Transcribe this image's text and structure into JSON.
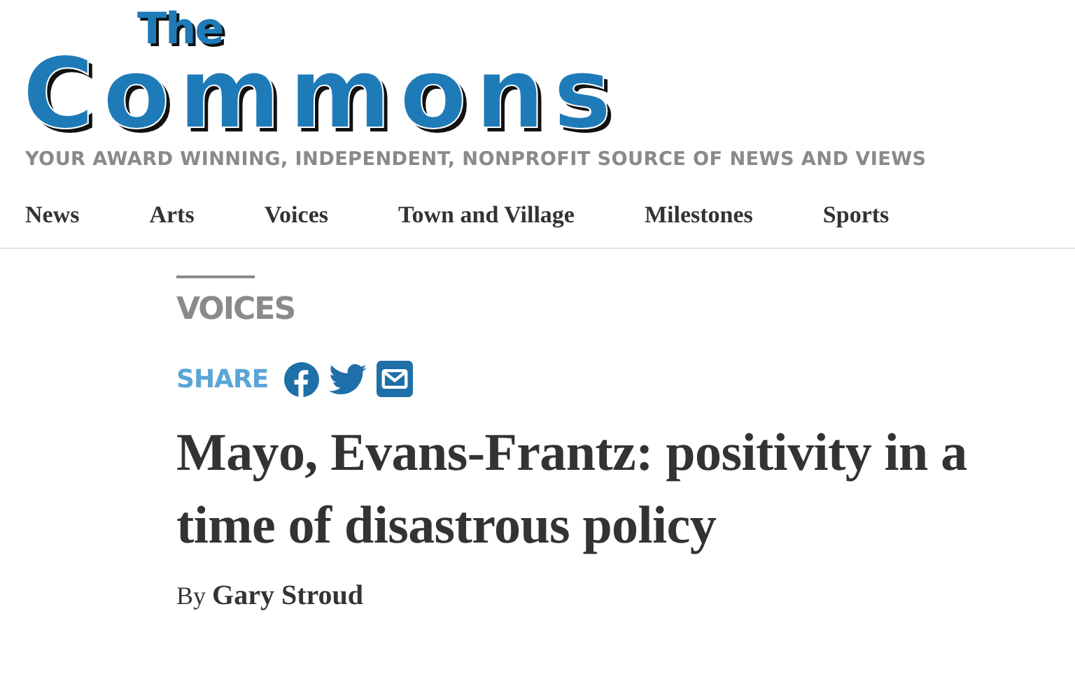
{
  "logo": {
    "small": "The",
    "large": "Commons"
  },
  "tagline": "YOUR AWARD WINNING, INDEPENDENT, NONPROFIT SOURCE OF NEWS AND VIEWS",
  "nav": [
    "News",
    "Arts",
    "Voices",
    "Town and Village",
    "Milestones",
    "Sports"
  ],
  "article": {
    "section": "VOICES",
    "share_label": "SHARE",
    "share_buttons": [
      {
        "kind": "facebook"
      },
      {
        "kind": "twitter"
      },
      {
        "kind": "email"
      }
    ],
    "headline": "Mayo, Evans-Frantz: positivity in a time of disastrous policy",
    "byline_prefix": "By",
    "author": "Gary Stroud"
  }
}
